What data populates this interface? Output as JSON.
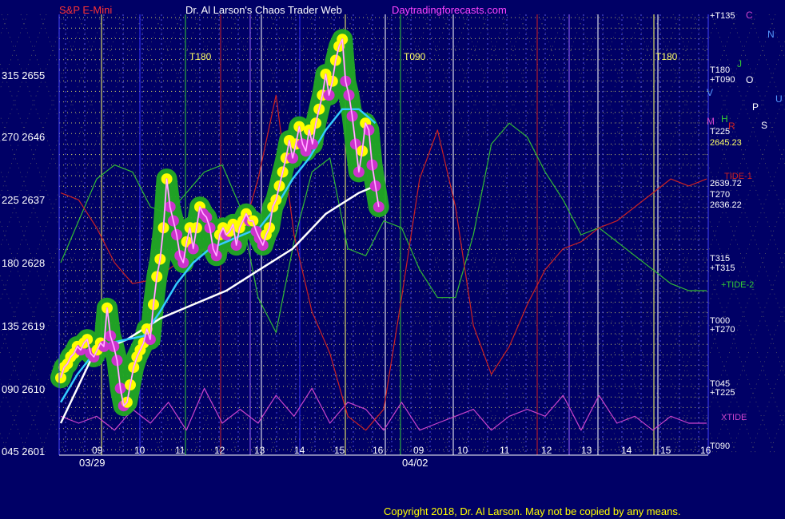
{
  "header": {
    "symbol": "S&P E-Mini",
    "app_title": "Dr. Al Larson's Chaos Trader Web",
    "site": "Daytradingforecasts.com"
  },
  "copyright": "Copyright 2018, Dr. Al Larson. May not be copied by any means.",
  "colors": {
    "background": "#000066",
    "price_glow": "#22aa22",
    "price_line": "#ff66ff",
    "moving_average_fast": "#33ccff",
    "moving_average_slow": "#ffffff",
    "tide_1": "#cc2222",
    "tide_2": "#33bb33",
    "xtide": "#cc44cc",
    "grid_dots": "#ffff66",
    "grid_lines": "#6666ff"
  },
  "chart_data": {
    "type": "line",
    "title": "S&P E-Mini",
    "y_axis_labels": [
      {
        "angle": "315",
        "price": "2655"
      },
      {
        "angle": "270",
        "price": "2646"
      },
      {
        "angle": "225",
        "price": "2637"
      },
      {
        "angle": "180",
        "price": "2628"
      },
      {
        "angle": "135",
        "price": "2619"
      },
      {
        "angle": "090",
        "price": "2610"
      },
      {
        "angle": "045",
        "price": "2601"
      }
    ],
    "ylim": [
      2601,
      2655
    ],
    "x_axis_labels": [
      "09",
      "10",
      "11",
      "12",
      "13",
      "14",
      "15",
      "16",
      "09",
      "10",
      "11",
      "12",
      "13",
      "14",
      "15",
      "16"
    ],
    "date_labels": [
      "03/29",
      "04/02"
    ],
    "series": [
      {
        "name": "price",
        "values": [
          [
            0,
            2611.5
          ],
          [
            0.2,
            2613
          ],
          [
            0.4,
            2613.5
          ],
          [
            0.6,
            2614.5
          ],
          [
            0.8,
            2615
          ],
          [
            1,
            2616
          ],
          [
            1.2,
            2615.5
          ],
          [
            1.4,
            2616.5
          ],
          [
            1.6,
            2617
          ],
          [
            1.8,
            2615
          ],
          [
            2,
            2614.5
          ],
          [
            2.2,
            2615.5
          ],
          [
            2.4,
            2616.5
          ],
          [
            2.6,
            2616
          ],
          [
            2.8,
            2621.5
          ],
          [
            3,
            2617.5
          ],
          [
            3.2,
            2616
          ],
          [
            3.4,
            2614
          ],
          [
            3.6,
            2610
          ],
          [
            3.8,
            2607.5
          ],
          [
            4,
            2608
          ],
          [
            4.2,
            2610.5
          ],
          [
            4.4,
            2613
          ],
          [
            4.6,
            2614.5
          ],
          [
            4.8,
            2615.5
          ],
          [
            5,
            2616.5
          ],
          [
            5.2,
            2618.5
          ],
          [
            5.4,
            2617
          ],
          [
            5.6,
            2622
          ],
          [
            5.8,
            2626
          ],
          [
            6,
            2628.5
          ],
          [
            6.2,
            2633
          ],
          [
            6.4,
            2640
          ],
          [
            6.6,
            2636
          ],
          [
            6.8,
            2634
          ],
          [
            7,
            2632
          ],
          [
            7.2,
            2629
          ],
          [
            7.4,
            2628
          ],
          [
            7.6,
            2631
          ],
          [
            7.8,
            2633
          ],
          [
            8,
            2630
          ],
          [
            8.2,
            2633
          ],
          [
            8.4,
            2636
          ],
          [
            8.6,
            2635
          ],
          [
            8.8,
            2634.5
          ],
          [
            9,
            2633
          ],
          [
            9.2,
            2630
          ],
          [
            9.4,
            2629
          ],
          [
            9.6,
            2632
          ],
          [
            9.8,
            2633
          ],
          [
            10,
            2632
          ],
          [
            10.2,
            2632.5
          ],
          [
            10.4,
            2633.5
          ],
          [
            10.6,
            2630.5
          ],
          [
            10.8,
            2633
          ],
          [
            11,
            2634
          ],
          [
            11.2,
            2635
          ],
          [
            11.4,
            2634
          ],
          [
            11.6,
            2634
          ],
          [
            11.8,
            2632.5
          ],
          [
            12,
            2631.5
          ],
          [
            12.2,
            2630.5
          ],
          [
            12.4,
            2632
          ],
          [
            12.6,
            2633
          ],
          [
            12.8,
            2636
          ],
          [
            13,
            2637
          ],
          [
            13.2,
            2639
          ],
          [
            13.4,
            2641
          ],
          [
            13.6,
            2643
          ],
          [
            13.8,
            2645.5
          ],
          [
            14,
            2643
          ],
          [
            14.2,
            2645
          ],
          [
            14.4,
            2647.5
          ],
          [
            14.6,
            2645
          ],
          [
            14.8,
            2644
          ],
          [
            15,
            2647
          ],
          [
            15.2,
            2645
          ],
          [
            15.4,
            2648
          ],
          [
            15.6,
            2650
          ],
          [
            15.8,
            2652
          ],
          [
            16,
            2655
          ],
          [
            16.2,
            2652
          ],
          [
            16.4,
            2654
          ],
          [
            16.6,
            2657
          ],
          [
            16.8,
            2659
          ],
          [
            17,
            2660
          ],
          [
            17.2,
            2654
          ],
          [
            17.4,
            2652
          ],
          [
            17.6,
            2649
          ],
          [
            17.8,
            2645
          ],
          [
            18,
            2641
          ],
          [
            18.2,
            2644
          ],
          [
            18.4,
            2648
          ],
          [
            18.6,
            2647
          ],
          [
            18.8,
            2642
          ],
          [
            19,
            2639
          ],
          [
            19.2,
            2636
          ]
        ]
      },
      {
        "name": "ma-fast",
        "values": [
          [
            0,
            2608
          ],
          [
            1,
            2612
          ],
          [
            2,
            2615
          ],
          [
            3,
            2616.5
          ],
          [
            4,
            2617
          ],
          [
            5,
            2617.5
          ],
          [
            6,
            2621
          ],
          [
            7,
            2625
          ],
          [
            8,
            2628
          ],
          [
            9,
            2630
          ],
          [
            10,
            2631
          ],
          [
            11,
            2632
          ],
          [
            12,
            2633
          ],
          [
            13,
            2636
          ],
          [
            14,
            2640
          ],
          [
            15,
            2643
          ],
          [
            16,
            2647
          ],
          [
            17,
            2650
          ],
          [
            18,
            2650
          ],
          [
            19,
            2648
          ]
        ]
      },
      {
        "name": "ma-slow",
        "values": [
          [
            0,
            2605
          ],
          [
            2,
            2615
          ],
          [
            4,
            2617
          ],
          [
            6,
            2620
          ],
          [
            8,
            2622
          ],
          [
            10,
            2624
          ],
          [
            12,
            2627
          ],
          [
            14,
            2630
          ],
          [
            16,
            2635
          ],
          [
            18,
            2638
          ],
          [
            19,
            2639
          ]
        ]
      },
      {
        "name": "TIDE-1",
        "values": [
          [
            0,
            2638
          ],
          [
            1,
            2637
          ],
          [
            2,
            2633
          ],
          [
            3,
            2628
          ],
          [
            4,
            2625
          ],
          [
            5,
            2625.5
          ],
          [
            6,
            2627
          ],
          [
            7,
            2629
          ],
          [
            8,
            2630
          ],
          [
            9,
            2629
          ],
          [
            10,
            2631
          ],
          [
            11,
            2640
          ],
          [
            12,
            2652
          ],
          [
            13,
            2632
          ],
          [
            14,
            2621
          ],
          [
            15,
            2615
          ],
          [
            16,
            2606
          ],
          [
            17,
            2604
          ],
          [
            18,
            2607
          ],
          [
            19,
            2623
          ],
          [
            20,
            2640
          ],
          [
            21,
            2647
          ],
          [
            22,
            2636
          ],
          [
            23,
            2619
          ],
          [
            24,
            2612
          ],
          [
            25,
            2616
          ],
          [
            26,
            2622
          ],
          [
            27,
            2627
          ],
          [
            28,
            2630
          ],
          [
            29,
            2631
          ],
          [
            30,
            2633
          ],
          [
            31,
            2634
          ],
          [
            32,
            2636
          ],
          [
            33,
            2638
          ],
          [
            34,
            2640
          ],
          [
            35,
            2639
          ],
          [
            36,
            2640
          ]
        ]
      },
      {
        "name": "TIDE-2",
        "values": [
          [
            0,
            2628
          ],
          [
            1,
            2634
          ],
          [
            2,
            2640
          ],
          [
            3,
            2642
          ],
          [
            4,
            2641
          ],
          [
            5,
            2636
          ],
          [
            6,
            2635
          ],
          [
            7,
            2638
          ],
          [
            8,
            2641
          ],
          [
            9,
            2642
          ],
          [
            10,
            2636
          ],
          [
            11,
            2623
          ],
          [
            12,
            2618
          ],
          [
            13,
            2631
          ],
          [
            14,
            2641
          ],
          [
            15,
            2643
          ],
          [
            16,
            2630
          ],
          [
            17,
            2629
          ],
          [
            18,
            2634
          ],
          [
            19,
            2633
          ],
          [
            20,
            2627
          ],
          [
            21,
            2623
          ],
          [
            22,
            2623
          ],
          [
            23,
            2632
          ],
          [
            24,
            2645
          ],
          [
            25,
            2648
          ],
          [
            26,
            2646
          ],
          [
            27,
            2641
          ],
          [
            28,
            2637
          ],
          [
            29,
            2632
          ],
          [
            30,
            2633
          ],
          [
            31,
            2631
          ],
          [
            32,
            2629
          ],
          [
            33,
            2627
          ],
          [
            34,
            2625
          ],
          [
            35,
            2624
          ],
          [
            36,
            2624
          ]
        ]
      },
      {
        "name": "XTIDE",
        "values": [
          [
            0,
            2606
          ],
          [
            1,
            2605
          ],
          [
            2,
            2606
          ],
          [
            3,
            2604
          ],
          [
            4,
            2607
          ],
          [
            5,
            2605
          ],
          [
            6,
            2608
          ],
          [
            7,
            2604
          ],
          [
            8,
            2610
          ],
          [
            9,
            2605
          ],
          [
            10,
            2607
          ],
          [
            11,
            2605
          ],
          [
            12,
            2609
          ],
          [
            13,
            2606
          ],
          [
            14,
            2610
          ],
          [
            15,
            2605
          ],
          [
            16,
            2608
          ],
          [
            17,
            2607
          ],
          [
            18,
            2604
          ],
          [
            19,
            2608
          ],
          [
            20,
            2604
          ],
          [
            21,
            2605
          ],
          [
            22,
            2606
          ],
          [
            23,
            2607
          ],
          [
            24,
            2604
          ],
          [
            25,
            2606
          ],
          [
            26,
            2607
          ],
          [
            27,
            2606
          ],
          [
            28,
            2609
          ],
          [
            29,
            2604
          ],
          [
            30,
            2609
          ],
          [
            31,
            2605
          ],
          [
            32,
            2606
          ],
          [
            33,
            2604
          ],
          [
            34,
            2606
          ],
          [
            35,
            2605
          ],
          [
            36,
            2605
          ]
        ]
      }
    ]
  },
  "right_labels": {
    "planet_glyphs": [
      {
        "text": "C",
        "color": "#cc44cc"
      },
      {
        "text": "N",
        "color": "#5599ff"
      },
      {
        "text": "J",
        "color": "#33cc33"
      },
      {
        "text": "O",
        "color": "#ffffff"
      },
      {
        "text": "U",
        "color": "#5599ff"
      },
      {
        "text": "V",
        "color": "#5599ff"
      },
      {
        "text": "P",
        "color": "#ffffff"
      },
      {
        "text": "M",
        "color": "#cc44cc"
      },
      {
        "text": "H",
        "color": "#33cc33"
      },
      {
        "text": "R",
        "color": "#cc2222"
      },
      {
        "text": "S",
        "color": "#ffffff"
      }
    ],
    "level_labels": [
      {
        "text": "+T135",
        "color": "#ffffff"
      },
      {
        "text": "T180",
        "color": "#ffffff"
      },
      {
        "text": "+T090",
        "color": "#ffffff"
      },
      {
        "text": "T225",
        "color": "#ffffff"
      },
      {
        "text": "2645.23",
        "color": "#ffff66"
      },
      {
        "text": "TIDE-1",
        "color": "#cc2222"
      },
      {
        "text": "2639.72",
        "color": "#ffffff"
      },
      {
        "text": "T270",
        "color": "#ffffff"
      },
      {
        "text": "2636.22",
        "color": "#ffffff"
      },
      {
        "text": "T315",
        "color": "#ffffff"
      },
      {
        "text": "+T315",
        "color": "#ffffff"
      },
      {
        "text": "+TIDE-2",
        "color": "#33cc33"
      },
      {
        "text": "T000",
        "color": "#ffffff"
      },
      {
        "text": "+T270",
        "color": "#ffffff"
      },
      {
        "text": "T045",
        "color": "#ffffff"
      },
      {
        "text": "+T225",
        "color": "#ffffff"
      },
      {
        "text": "XTIDE",
        "color": "#cc44cc"
      },
      {
        "text": "T090",
        "color": "#ffffff"
      }
    ],
    "inline_labels": [
      {
        "text": "T180",
        "color": "#ffff66"
      },
      {
        "text": "T090",
        "color": "#ffff66"
      },
      {
        "text": "T180",
        "color": "#ffff66"
      }
    ]
  }
}
